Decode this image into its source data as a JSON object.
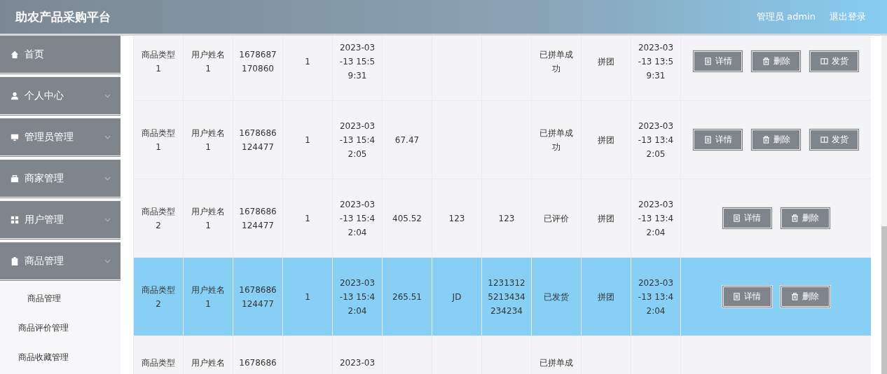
{
  "header": {
    "title": "助农产品采购平台",
    "user": "管理员 admin",
    "logout": "退出登录"
  },
  "sidebar": {
    "items": [
      {
        "label": "首页",
        "collapsible": false
      },
      {
        "label": "个人中心",
        "collapsible": true
      },
      {
        "label": "管理员管理",
        "collapsible": true
      },
      {
        "label": "商家管理",
        "collapsible": true
      },
      {
        "label": "用户管理",
        "collapsible": true
      },
      {
        "label": "商品管理",
        "collapsible": true,
        "children": [
          {
            "label": "商品管理"
          },
          {
            "label": "商品评价管理"
          },
          {
            "label": "商品收藏管理"
          }
        ]
      }
    ]
  },
  "table": {
    "rows": [
      {
        "selected": false,
        "cells": [
          "商品类型1",
          "用户姓名1",
          "1678687170860",
          "1",
          "2023-03-13 15:59:31",
          "",
          "",
          "",
          "已拼单成功",
          "拼团",
          "2023-03-13 13:59:31"
        ],
        "actions": [
          {
            "kind": "detail",
            "label": "详情"
          },
          {
            "kind": "delete",
            "label": "删除"
          },
          {
            "kind": "ship",
            "label": "发货"
          }
        ]
      },
      {
        "selected": false,
        "cells": [
          "商品类型1",
          "用户姓名1",
          "1678686124477",
          "1",
          "2023-03-13 15:42:05",
          "67.47",
          "",
          "",
          "已拼单成功",
          "拼团",
          "2023-03-13 13:42:05"
        ],
        "actions": [
          {
            "kind": "detail",
            "label": "详情"
          },
          {
            "kind": "delete",
            "label": "删除"
          },
          {
            "kind": "ship",
            "label": "发货"
          }
        ]
      },
      {
        "selected": false,
        "cells": [
          "商品类型2",
          "用户姓名1",
          "1678686124477",
          "1",
          "2023-03-13 15:42:04",
          "405.52",
          "123",
          "123",
          "已评价",
          "拼团",
          "2023-03-13 13:42:04"
        ],
        "actions": [
          {
            "kind": "detail",
            "label": "详情"
          },
          {
            "kind": "delete",
            "label": "删除"
          }
        ]
      },
      {
        "selected": true,
        "cells": [
          "商品类型2",
          "用户姓名1",
          "1678686124477",
          "1",
          "2023-03-13 15:42:04",
          "265.51",
          "JD",
          "12313125213434234234",
          "已发货",
          "拼团",
          "2023-03-13 13:42:04"
        ],
        "actions": [
          {
            "kind": "detail",
            "label": "详情"
          },
          {
            "kind": "delete",
            "label": "删除"
          }
        ]
      },
      {
        "selected": false,
        "cells": [
          "商品类型",
          "用户姓名",
          "1678686",
          "",
          "2023-03",
          "",
          "",
          "",
          "已拼单成",
          "",
          ""
        ],
        "actions": []
      }
    ]
  }
}
